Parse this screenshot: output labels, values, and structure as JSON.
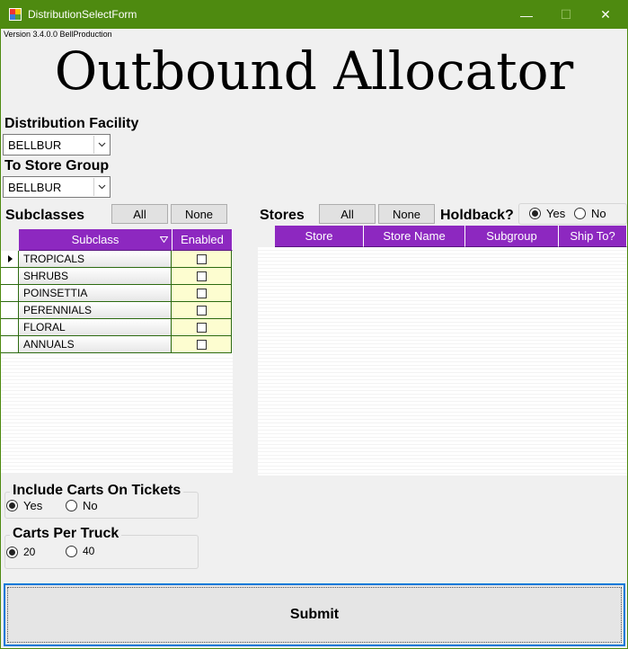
{
  "window": {
    "title": "DistributionSelectForm",
    "minimize_glyph": "—",
    "maximize_glyph": "☐",
    "close_glyph": "✕"
  },
  "version": "Version 3.4.0.0 BellProduction",
  "app_title": "Outbound Allocator",
  "distribution_facility": {
    "label": "Distribution Facility",
    "value": "BELLBUR"
  },
  "to_store_group": {
    "label": "To Store Group",
    "value": "BELLBUR"
  },
  "subclasses": {
    "label": "Subclasses",
    "all_label": "All",
    "none_label": "None",
    "columns": [
      "Subclass",
      "Enabled"
    ],
    "rows": [
      {
        "name": "TROPICALS",
        "enabled": false
      },
      {
        "name": "SHRUBS",
        "enabled": false
      },
      {
        "name": "POINSETTIA",
        "enabled": false
      },
      {
        "name": "PERENNIALS",
        "enabled": false
      },
      {
        "name": "FLORAL",
        "enabled": false
      },
      {
        "name": "ANNUALS",
        "enabled": false
      }
    ]
  },
  "stores": {
    "label": "Stores",
    "all_label": "All",
    "none_label": "None",
    "columns": [
      "Store",
      "Store Name",
      "Subgroup",
      "Ship To?"
    ]
  },
  "holdback": {
    "label": "Holdback?",
    "yes": "Yes",
    "no": "No",
    "selected": "Yes"
  },
  "include_carts": {
    "label": "Include Carts On Tickets",
    "yes": "Yes",
    "no": "No",
    "selected": "Yes"
  },
  "carts_per_truck": {
    "label": "Carts Per Truck",
    "opt1": "20",
    "opt2": "40",
    "selected": "20"
  },
  "submit_label": "Submit",
  "colors": {
    "titlebar": "#4e8a10",
    "grid_header": "#8d28c0",
    "enabled_cell": "#fdfdd0",
    "grid_border": "#2c6a10"
  }
}
